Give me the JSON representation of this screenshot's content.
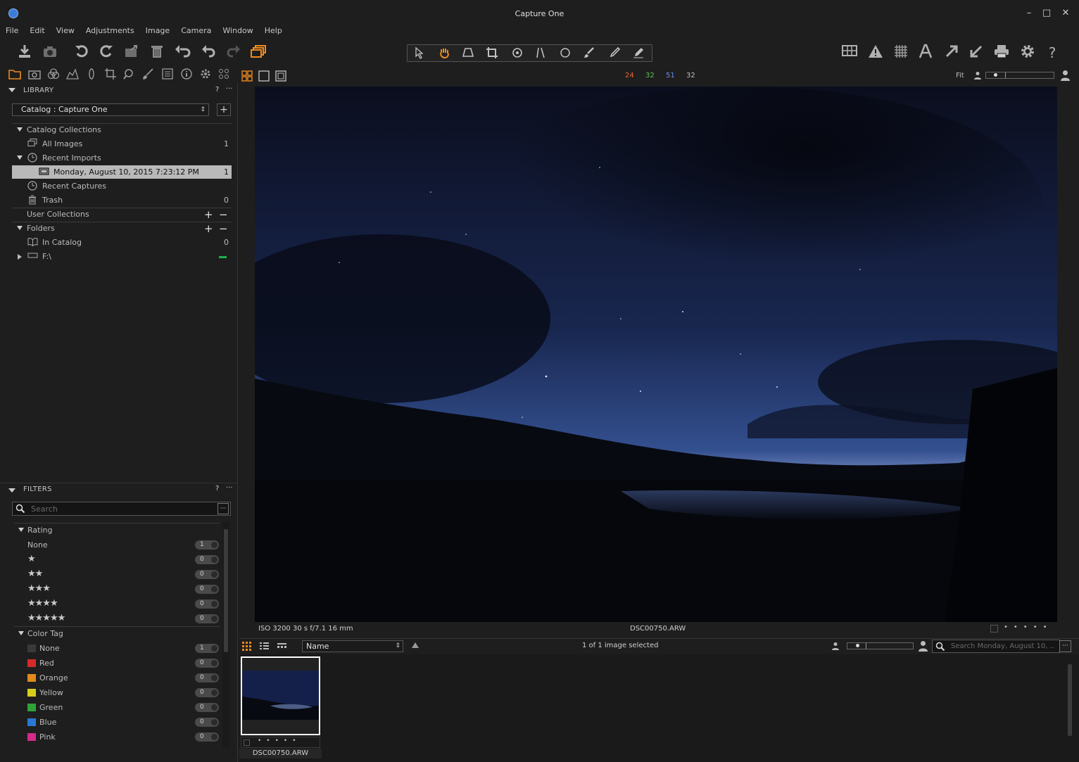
{
  "window": {
    "title": "Capture One",
    "controls": [
      "–",
      "□",
      "✕"
    ]
  },
  "menu": [
    "File",
    "Edit",
    "View",
    "Adjustments",
    "Image",
    "Camera",
    "Window",
    "Help"
  ],
  "toolbar": {
    "left_icons": [
      "import-icon",
      "camera-icon",
      "rotate-left-icon",
      "rotate-right-icon",
      "move-to-folder-icon",
      "trash-icon",
      "undo-all-icon",
      "undo-icon",
      "redo-icon",
      "variants-icon"
    ],
    "cursor_tools": [
      "select-icon",
      "pan-icon",
      "keystone-icon",
      "crop-icon",
      "rotate-icon",
      "straighten-icon",
      "spot-icon",
      "brush-icon",
      "picker-icon",
      "eraser-icon"
    ],
    "right_icons": [
      "grid-icon",
      "exposure-warning-icon",
      "focus-mask-icon",
      "text-icon",
      "export-icon",
      "import-arrow-icon",
      "print-icon",
      "settings-icon",
      "help-icon"
    ]
  },
  "viewer_top": {
    "levels": {
      "r": "24",
      "g": "32",
      "b": "51",
      "l": "32"
    },
    "fit_label": "Fit"
  },
  "library": {
    "header": "LIBRARY",
    "help": "?",
    "more": "···",
    "catalog_prefix": "Catalog :",
    "catalog_name": "Capture One",
    "catalog_collections": "Catalog Collections",
    "all_images": {
      "label": "All Images",
      "count": "1"
    },
    "recent_imports": {
      "label": "Recent Imports"
    },
    "import_item": {
      "label": "Monday, August 10, 2015 7:23:12 PM",
      "count": "1"
    },
    "recent_captures": {
      "label": "Recent Captures"
    },
    "trash": {
      "label": "Trash",
      "count": "0"
    },
    "user_collections": "User Collections",
    "folders": "Folders",
    "in_catalog": {
      "label": "In Catalog",
      "count": "0"
    },
    "drive": {
      "label": "F:\\"
    }
  },
  "filters": {
    "header": "FILTERS",
    "help": "?",
    "more": "···",
    "search_placeholder": "Search",
    "rating_label": "Rating",
    "ratings": [
      {
        "label": "None",
        "stars": "",
        "count": "1"
      },
      {
        "label": "",
        "stars": "★",
        "count": "0"
      },
      {
        "label": "",
        "stars": "★★",
        "count": "0"
      },
      {
        "label": "",
        "stars": "★★★",
        "count": "0"
      },
      {
        "label": "",
        "stars": "★★★★",
        "count": "0"
      },
      {
        "label": "",
        "stars": "★★★★★",
        "count": "0"
      }
    ],
    "color_tag_label": "Color Tag",
    "color_tags": [
      {
        "label": "None",
        "color": "#3a3a3a",
        "count": "1"
      },
      {
        "label": "Red",
        "color": "#d42a2a",
        "count": "0"
      },
      {
        "label": "Orange",
        "color": "#e08a1a",
        "count": "0"
      },
      {
        "label": "Yellow",
        "color": "#d6cf1a",
        "count": "0"
      },
      {
        "label": "Green",
        "color": "#2ea33a",
        "count": "0"
      },
      {
        "label": "Blue",
        "color": "#2a78d4",
        "count": "0"
      },
      {
        "label": "Pink",
        "color": "#d42a8a",
        "count": "0"
      }
    ]
  },
  "viewer": {
    "info_left": "ISO 3200 30 s f/7.1 16 mm",
    "filename": "DSC00750.ARW"
  },
  "browser": {
    "sort_by": "Name",
    "selection_status": "1 of 1 image selected",
    "search_placeholder": "Search Monday, August 10, ..",
    "thumbnail_name": "DSC00750.ARW"
  },
  "colors": {
    "accent": "#f08a1e",
    "selected_row": "#b9b9b9",
    "background": "#1e1e1e"
  }
}
